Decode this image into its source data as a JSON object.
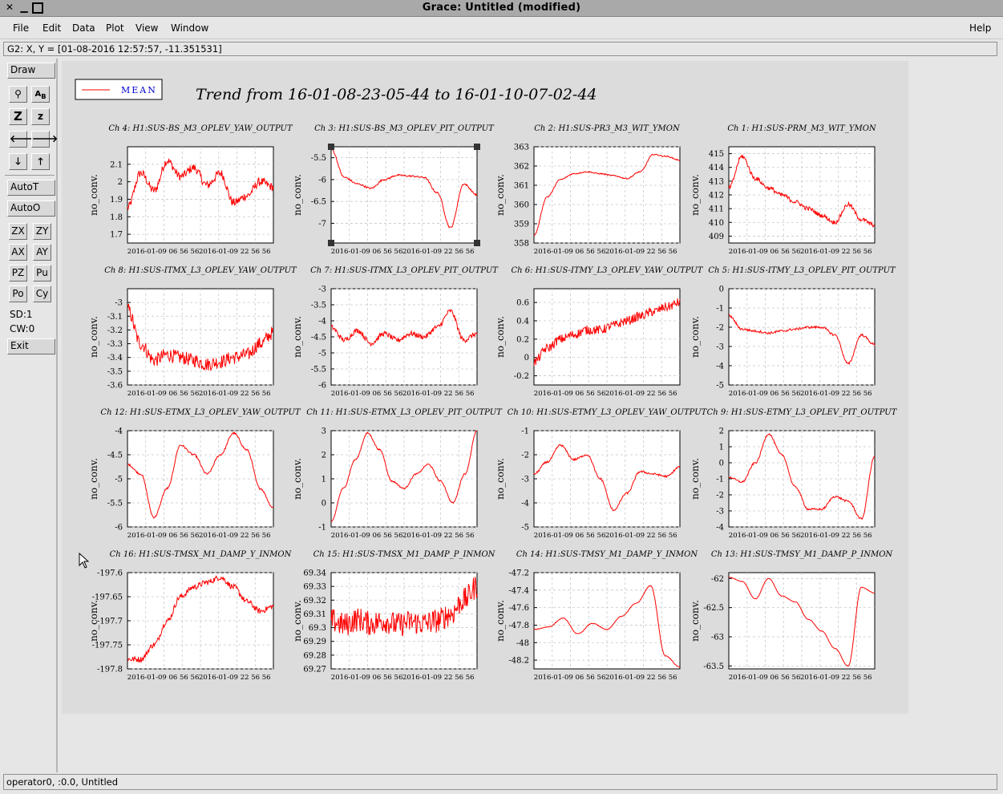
{
  "window": {
    "title": "Grace: Untitled (modified)"
  },
  "menubar": {
    "items": [
      "File",
      "Edit",
      "Data",
      "Plot",
      "View",
      "Window"
    ],
    "help": "Help"
  },
  "locator": "G2: X, Y = [01-08-2016 12:57:57, -11.351531]",
  "toolbar": {
    "draw": "Draw",
    "autot": "AutoT",
    "autoo": "AutoO",
    "exit": "Exit",
    "zx": "ZX",
    "zy": "ZY",
    "ax": "AX",
    "ay": "AY",
    "pz": "PZ",
    "pu": "Pu",
    "po": "Po",
    "cy": "Cy",
    "zoom_z": "Z",
    "zoom_z_small": "z",
    "sd": "SD:1",
    "cw": "CW:0"
  },
  "status": "operator0, :0.0, Untitled",
  "canvas": {
    "title": "Trend from 16-01-08-23-05-44 to 16-01-10-07-02-44",
    "legend": "MEAN",
    "line_color": "#ff0000"
  },
  "chart_data": [
    {
      "type": "line",
      "title": "Ch 4: H1:SUS-BS_M3_OPLEV_YAW_OUTPUT",
      "ylabel": "no_conv.",
      "ylim": [
        1.65,
        2.2
      ],
      "yticks": [
        "2.1",
        "2",
        "1.9",
        "1.8",
        "1.7"
      ],
      "ytick_values": [
        2.1,
        2.0,
        1.9,
        1.8,
        1.7
      ],
      "xticks": [
        "2016-01-09 06 56 56",
        "2016-01-09 22 56 56"
      ],
      "keypoints": [
        1.85,
        2.05,
        1.95,
        2.12,
        2.03,
        2.08,
        1.98,
        2.05,
        1.88,
        1.92,
        2.0,
        1.97
      ],
      "noise": 0.025,
      "series": [
        {
          "name": "MEAN"
        }
      ]
    },
    {
      "type": "line",
      "title": "Ch 8: H1:SUS-ITMX_L3_OPLEV_YAW_OUTPUT",
      "ylabel": "no_conv.",
      "ylim": [
        -3.6,
        -2.9
      ],
      "yticks": [
        "-3",
        "-3.1",
        "-3.2",
        "-3.3",
        "-3.4",
        "-3.5",
        "-3.6"
      ],
      "ytick_values": [
        -3,
        -3.1,
        -3.2,
        -3.3,
        -3.4,
        -3.5,
        -3.6
      ],
      "xticks": [
        "2016-01-09 06 56 56",
        "2016-01-09 22 56 56"
      ],
      "keypoints": [
        -3.05,
        -3.3,
        -3.42,
        -3.38,
        -3.4,
        -3.42,
        -3.45,
        -3.43,
        -3.4,
        -3.38,
        -3.3,
        -3.22
      ],
      "noise": 0.05,
      "series": [
        {
          "name": "MEAN"
        }
      ]
    },
    {
      "type": "line",
      "title": "Ch 12: H1:SUS-ETMX_L3_OPLEV_YAW_OUTPUT",
      "ylabel": "no_conv.",
      "ylim": [
        -6,
        -4
      ],
      "yticks": [
        "-4",
        "-4.5",
        "-5",
        "-5.5",
        "-6"
      ],
      "ytick_values": [
        -4,
        -4.5,
        -5,
        -5.5,
        -6
      ],
      "xticks": [
        "2016-01-09 06 56 56",
        "2016-01-09 22 56 56"
      ],
      "keypoints": [
        -4.7,
        -4.9,
        -5.8,
        -5.2,
        -4.3,
        -4.5,
        -4.9,
        -4.5,
        -4.05,
        -4.4,
        -5.2,
        -5.6
      ],
      "noise": 0.02,
      "series": [
        {
          "name": "MEAN"
        }
      ]
    },
    {
      "type": "line",
      "title": "Ch 16: H1:SUS-TMSX_M1_DAMP_Y_INMON",
      "ylabel": "no_conv.",
      "ylim": [
        -197.8,
        -197.6
      ],
      "yticks": [
        "-197.6",
        "-197.65",
        "-197.7",
        "-197.75",
        "-197.8"
      ],
      "ytick_values": [
        -197.6,
        -197.65,
        -197.7,
        -197.75,
        -197.8
      ],
      "xticks": [
        "2016-01-09 06 56 56",
        "2016-01-09 22 56 56"
      ],
      "keypoints": [
        -197.78,
        -197.78,
        -197.75,
        -197.7,
        -197.65,
        -197.63,
        -197.62,
        -197.61,
        -197.63,
        -197.66,
        -197.68,
        -197.67
      ],
      "noise": 0.006,
      "series": [
        {
          "name": "MEAN"
        }
      ]
    },
    {
      "type": "line",
      "title": "Ch 3: H1:SUS-BS_M3_OPLEV_PIT_OUTPUT",
      "ylabel": "no_conv.",
      "ylim": [
        -7.45,
        -5.25
      ],
      "yticks": [
        "-5.5",
        "-6",
        "-6.5",
        "-7"
      ],
      "ytick_values": [
        -5.5,
        -6,
        -6.5,
        -7
      ],
      "xticks": [
        "2016-01-09 06 56 56",
        "2016-01-09 22 56 56"
      ],
      "keypoints": [
        -5.3,
        -5.95,
        -6.1,
        -6.2,
        -6.0,
        -5.9,
        -5.92,
        -5.95,
        -6.3,
        -7.1,
        -6.1,
        -6.35
      ],
      "noise": 0.02,
      "series": [
        {
          "name": "MEAN"
        }
      ]
    },
    {
      "type": "line",
      "title": "Ch 7: H1:SUS-ITMX_L3_OPLEV_PIT_OUTPUT",
      "ylabel": "no_conv.",
      "ylim": [
        -6,
        -3
      ],
      "yticks": [
        "-3",
        "-3.5",
        "-4",
        "-4.5",
        "-5",
        "-5.5",
        "-6"
      ],
      "ytick_values": [
        -3,
        -3.5,
        -4,
        -4.5,
        -5,
        -5.5,
        -6
      ],
      "xticks": [
        "2016-01-09 06 56 56",
        "2016-01-09 22 56 56"
      ],
      "keypoints": [
        -4.2,
        -4.6,
        -4.3,
        -4.7,
        -4.4,
        -4.6,
        -4.4,
        -4.5,
        -4.2,
        -3.7,
        -4.6,
        -4.4
      ],
      "noise": 0.08,
      "series": [
        {
          "name": "MEAN"
        }
      ]
    },
    {
      "type": "line",
      "title": "Ch 11: H1:SUS-ETMX_L3_OPLEV_PIT_OUTPUT",
      "ylabel": "no_conv.",
      "ylim": [
        -1,
        3
      ],
      "yticks": [
        "3",
        "2",
        "1",
        "0",
        "-1"
      ],
      "ytick_values": [
        3,
        2,
        1,
        0,
        -1
      ],
      "xticks": [
        "2016-01-09 06 56 56",
        "2016-01-09 22 56 56"
      ],
      "keypoints": [
        -0.8,
        0.6,
        1.8,
        2.9,
        2.2,
        0.9,
        0.6,
        1.2,
        1.6,
        0.9,
        0.0,
        1.2,
        3.0
      ],
      "noise": 0.03,
      "series": [
        {
          "name": "MEAN"
        }
      ]
    },
    {
      "type": "line",
      "title": "Ch 15: H1:SUS-TMSX_M1_DAMP_P_INMON",
      "ylabel": "no_conv.",
      "ylim": [
        69.27,
        69.34
      ],
      "yticks": [
        "69.34",
        "69.33",
        "69.32",
        "69.31",
        "69.3",
        "69.29",
        "69.28",
        "69.27"
      ],
      "ytick_values": [
        69.34,
        69.33,
        69.32,
        69.31,
        69.3,
        69.29,
        69.28,
        69.27
      ],
      "xticks": [
        "2016-01-09 06 56 56",
        "2016-01-09 22 56 56"
      ],
      "keypoints": [
        69.305,
        69.302,
        69.306,
        69.303,
        69.305,
        69.302,
        69.304,
        69.303,
        69.305,
        69.31,
        69.32,
        69.33
      ],
      "noise": 0.009,
      "series": [
        {
          "name": "MEAN"
        }
      ]
    },
    {
      "type": "line",
      "title": "Ch 2: H1:SUS-PR3_M3_WIT_YMON",
      "ylabel": "no_conv.",
      "ylim": [
        358,
        363
      ],
      "yticks": [
        "363",
        "362",
        "361",
        "360",
        "359",
        "358"
      ],
      "ytick_values": [
        363,
        362,
        361,
        360,
        359,
        358
      ],
      "xticks": [
        "2016-01-09 06 56 56",
        "2016-01-09 22 56 56"
      ],
      "keypoints": [
        358.4,
        360.4,
        361.3,
        361.6,
        361.7,
        361.6,
        361.5,
        361.35,
        361.7,
        362.6,
        362.5,
        362.3
      ],
      "noise": 0.03,
      "series": [
        {
          "name": "MEAN"
        }
      ]
    },
    {
      "type": "line",
      "title": "Ch 6: H1:SUS-ITMY_L3_OPLEV_YAW_OUTPUT",
      "ylabel": "no_conv.",
      "ylim": [
        -0.3,
        0.75
      ],
      "yticks": [
        "0.6",
        "0.4",
        "0.2",
        "0",
        "-0.2"
      ],
      "ytick_values": [
        0.6,
        0.4,
        0.2,
        0,
        -0.2
      ],
      "xticks": [
        "2016-01-09 06 56 56",
        "2016-01-09 22 56 56"
      ],
      "keypoints": [
        -0.05,
        0.1,
        0.2,
        0.25,
        0.3,
        0.3,
        0.35,
        0.4,
        0.45,
        0.5,
        0.55,
        0.6
      ],
      "noise": 0.05,
      "series": [
        {
          "name": "MEAN"
        }
      ]
    },
    {
      "type": "line",
      "title": "Ch 10: H1:SUS-ETMY_L3_OPLEV_YAW_OUTPUT",
      "ylabel": "no_conv.",
      "ylim": [
        -5,
        -1
      ],
      "yticks": [
        "-1",
        "-2",
        "-3",
        "-4",
        "-5"
      ],
      "ytick_values": [
        -1,
        -2,
        -3,
        -4,
        -5
      ],
      "xticks": [
        "2016-01-09 06 56 56",
        "2016-01-09 22 56 56"
      ],
      "keypoints": [
        -2.8,
        -2.3,
        -1.6,
        -2.2,
        -2.0,
        -3.0,
        -4.3,
        -3.6,
        -2.7,
        -2.8,
        -2.9,
        -2.5
      ],
      "noise": 0.04,
      "series": [
        {
          "name": "MEAN"
        }
      ]
    },
    {
      "type": "line",
      "title": "Ch 14: H1:SUS-TMSY_M1_DAMP_Y_INMON",
      "ylabel": "no_conv.",
      "ylim": [
        -48.3,
        -47.2
      ],
      "yticks": [
        "-47.2",
        "-47.4",
        "-47.6",
        "-47.8",
        "-48",
        "-48.2"
      ],
      "ytick_values": [
        -47.2,
        -47.4,
        -47.6,
        -47.8,
        -48,
        -48.2
      ],
      "xticks": [
        "2016-01-09 06 56 56",
        "2016-01-09 22 56 56"
      ],
      "keypoints": [
        -47.85,
        -47.82,
        -47.72,
        -47.9,
        -47.78,
        -47.85,
        -47.7,
        -47.55,
        -47.35,
        -48.15,
        -48.28
      ],
      "noise": 0.004,
      "series": [
        {
          "name": "MEAN"
        }
      ]
    },
    {
      "type": "line",
      "title": "Ch 1: H1:SUS-PRM_M3_WIT_YMON",
      "ylabel": "no_conv.",
      "ylim": [
        408.5,
        415.5
      ],
      "yticks": [
        "415",
        "414",
        "413",
        "412",
        "411",
        "410",
        "409"
      ],
      "ytick_values": [
        415,
        414,
        413,
        412,
        411,
        410,
        409
      ],
      "xticks": [
        "2016-01-09 06 56 56",
        "2016-01-09 22 56 56"
      ],
      "keypoints": [
        412.5,
        414.8,
        413.2,
        412.5,
        412.0,
        411.5,
        411.0,
        410.5,
        410.0,
        411.3,
        410.2,
        409.8
      ],
      "noise": 0.15,
      "series": [
        {
          "name": "MEAN"
        }
      ]
    },
    {
      "type": "line",
      "title": "Ch 5: H1:SUS-ITMY_L3_OPLEV_PIT_OUTPUT",
      "ylabel": "no_conv.",
      "ylim": [
        -5,
        0
      ],
      "yticks": [
        "0",
        "-1",
        "-2",
        "-3",
        "-4",
        "-5"
      ],
      "ytick_values": [
        0,
        -1,
        -2,
        -3,
        -4,
        -5
      ],
      "xticks": [
        "2016-01-09 06 56 56",
        "2016-01-09 22 56 56"
      ],
      "keypoints": [
        -1.4,
        -2.1,
        -2.2,
        -2.3,
        -2.2,
        -2.1,
        -2.0,
        -2.0,
        -2.4,
        -3.9,
        -2.4,
        -2.9
      ],
      "noise": 0.06,
      "series": [
        {
          "name": "MEAN"
        }
      ]
    },
    {
      "type": "line",
      "title": "Ch 9: H1:SUS-ETMY_L3_OPLEV_PIT_OUTPUT",
      "ylabel": "no_conv.",
      "ylim": [
        -4,
        2
      ],
      "yticks": [
        "2",
        "1",
        "0",
        "-1",
        "-2",
        "-3",
        "-4"
      ],
      "ytick_values": [
        2,
        1,
        0,
        -1,
        -2,
        -3,
        -4
      ],
      "xticks": [
        "2016-01-09 06 56 56",
        "2016-01-09 22 56 56"
      ],
      "keypoints": [
        -0.9,
        -1.2,
        0.0,
        1.8,
        0.5,
        -1.5,
        -2.9,
        -2.9,
        -2.1,
        -2.4,
        -3.5,
        0.4
      ],
      "noise": 0.06,
      "series": [
        {
          "name": "MEAN"
        }
      ]
    },
    {
      "type": "line",
      "title": "Ch 13: H1:SUS-TMSY_M1_DAMP_P_INMON",
      "ylabel": "no_conv.",
      "ylim": [
        -63.55,
        -61.9
      ],
      "yticks": [
        "-62",
        "-62.5",
        "-63",
        "-63.5"
      ],
      "ytick_values": [
        -62,
        -62.5,
        -63,
        -63.5
      ],
      "xticks": [
        "2016-01-09 06 56 56",
        "2016-01-09 22 56 56"
      ],
      "keypoints": [
        -61.98,
        -62.05,
        -62.35,
        -62.0,
        -62.3,
        -62.4,
        -62.7,
        -62.9,
        -63.2,
        -63.5,
        -62.15,
        -62.25
      ],
      "noise": 0.004,
      "series": [
        {
          "name": "MEAN"
        }
      ]
    }
  ]
}
